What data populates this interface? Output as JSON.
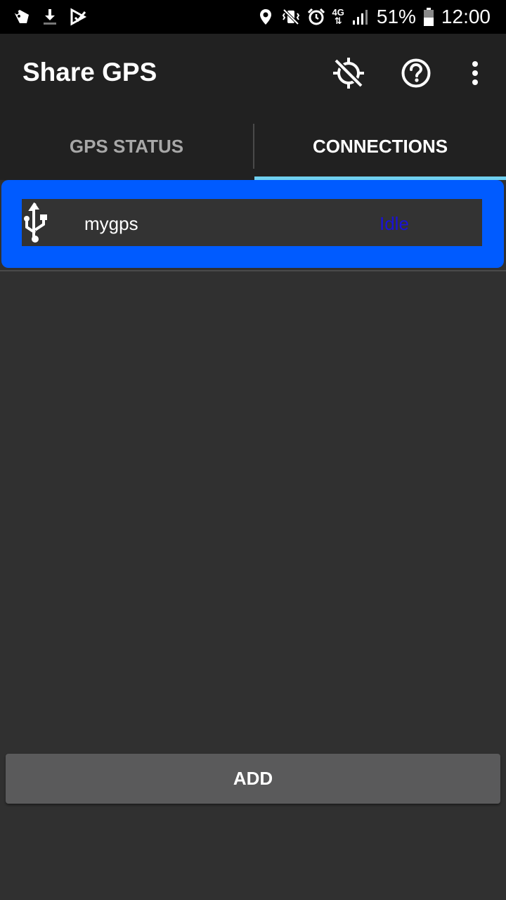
{
  "status_bar": {
    "battery_percent": "51%",
    "time": "12:00",
    "network_label": "4G",
    "left_icons": [
      "notification-app-icon",
      "download-icon",
      "play-store-icon"
    ],
    "right_icons": [
      "location-icon",
      "vibrate-icon",
      "alarm-icon",
      "network-4g-icon",
      "signal-icon",
      "battery-icon"
    ]
  },
  "app_bar": {
    "title": "Share GPS",
    "actions": [
      "gps-off-icon",
      "help-icon",
      "more-options-icon"
    ]
  },
  "tabs": [
    {
      "label": "GPS STATUS",
      "selected": false
    },
    {
      "label": "CONNECTIONS",
      "selected": true
    }
  ],
  "connections": [
    {
      "name": "mygps",
      "status": "Idle",
      "icon": "usb-icon"
    }
  ],
  "footer": {
    "add_label": "ADD"
  },
  "colors": {
    "status_bar_bg": "#000000",
    "app_bar_bg": "#212121",
    "content_bg": "#303030",
    "tab_indicator": "#6fd0f0",
    "selected_item_highlight": "#005bff",
    "status_idle": "#1a12d6",
    "button_bg": "#5a5a5b"
  }
}
